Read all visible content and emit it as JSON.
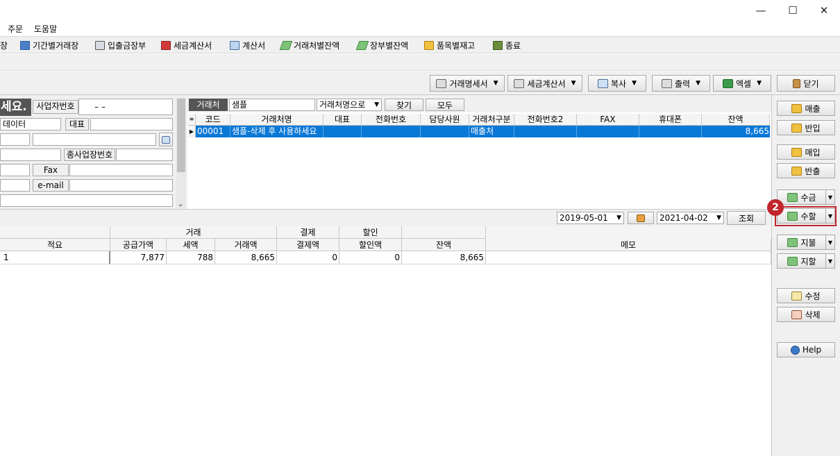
{
  "window": {
    "minimize_glyph": "—",
    "maximize_glyph": "☐",
    "close_glyph": "✕"
  },
  "menu": [
    "주문",
    "도움말"
  ],
  "toolbar": [
    {
      "label": "장",
      "icon": "none"
    },
    {
      "label": "기간별거래장",
      "icon": "ledger-icon"
    },
    {
      "label": "입출금장부",
      "icon": "calculator-icon"
    },
    {
      "label": "세금계산서",
      "icon": "tax-invoice-icon"
    },
    {
      "label": "계산서",
      "icon": "invoice-icon"
    },
    {
      "label": "거래처별잔액",
      "icon": "money-icon"
    },
    {
      "label": "장부별잔액",
      "icon": "money-icon"
    },
    {
      "label": "품목별재고",
      "icon": "box-icon"
    },
    {
      "label": "종료",
      "icon": "exit-icon"
    }
  ],
  "actions": {
    "statement": "거래명세서",
    "tax_invoice": "세금계산서",
    "copy": "복사",
    "print": "출력",
    "excel": "엑셀",
    "close": "닫기"
  },
  "form": {
    "heading": "세요.",
    "biz_no_label": "사업자번호",
    "biz_no_value": "–    –",
    "data_text": "데이터",
    "rep_label": "대표",
    "sub_biz_label": "종사업장번호",
    "fax_label": "Fax",
    "email_label": "e-mail"
  },
  "search": {
    "label": "거래처",
    "value": "샘플",
    "mode": "거래처명으로",
    "find": "찾기",
    "all": "모두"
  },
  "client_grid": {
    "columns": [
      "코드",
      "거래처명",
      "대표",
      "전화번호",
      "담당사원",
      "거래처구분",
      "전화번호2",
      "FAX",
      "휴대폰",
      "잔액"
    ],
    "rows": [
      {
        "code": "00001",
        "name": "샘플-삭제 후 사용하세요",
        "rep": "",
        "phone": "",
        "staff": "",
        "type": "매출처",
        "phone2": "",
        "fax": "",
        "mobile": "",
        "balance": "8,665"
      }
    ]
  },
  "date_filter": {
    "from": "2019-05-01",
    "to": "2021-04-02",
    "query": "조회"
  },
  "ledger_grid": {
    "group_trade": "거래",
    "group_payment": "결제",
    "group_discount": "할인",
    "col_memo_desc": "적요",
    "col_supply": "공급가액",
    "col_tax": "세액",
    "col_trade_amt": "거래액",
    "col_pay_amt": "결제액",
    "col_disc_amt": "할인액",
    "col_balance": "잔액",
    "col_memo": "메모",
    "rows": [
      {
        "desc": "1",
        "supply": "7,877",
        "tax": "788",
        "trade": "8,665",
        "pay": "0",
        "disc": "0",
        "balance": "8,665",
        "memo": ""
      }
    ]
  },
  "side_buttons": {
    "sales": "매출",
    "sales_return": "반입",
    "purchase": "매입",
    "purchase_return": "반출",
    "receive": "수금",
    "receive_discount": "수할",
    "pay": "지불",
    "pay_discount": "지할",
    "edit": "수정",
    "delete": "삭제",
    "help": "Help"
  },
  "annotation": {
    "badge": "2",
    "color": "#c0262c"
  }
}
